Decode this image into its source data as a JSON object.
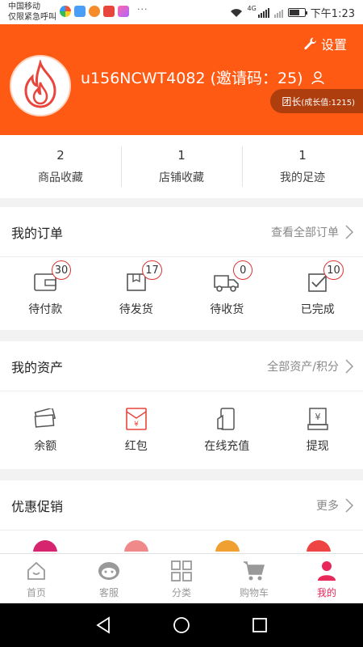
{
  "status_bar": {
    "carrier_line1": "中国移动",
    "carrier_line2": "仅限紧急呼叫",
    "dots": "···",
    "network": "4G",
    "time": "下午1:23"
  },
  "header": {
    "settings_label": "设置",
    "username": "u156NCWT4082 (邀请码：25)",
    "level_label": "团长",
    "growth_label": "(成长值:1215)",
    "bg_color": "#ff5a14"
  },
  "stats": [
    {
      "count": "2",
      "label": "商品收藏"
    },
    {
      "count": "1",
      "label": "店铺收藏"
    },
    {
      "count": "1",
      "label": "我的足迹"
    }
  ],
  "orders": {
    "title": "我的订单",
    "more_label": "查看全部订单",
    "items": [
      {
        "label": "待付款",
        "badge": "30",
        "icon": "wallet-icon"
      },
      {
        "label": "待发货",
        "badge": "17",
        "icon": "package-icon"
      },
      {
        "label": "待收货",
        "badge": "0",
        "icon": "truck-icon"
      },
      {
        "label": "已完成",
        "badge": "10",
        "icon": "checkbox-icon"
      }
    ]
  },
  "assets": {
    "title": "我的资产",
    "more_label": "全部资产/积分",
    "items": [
      {
        "label": "余额",
        "icon": "cash-icon"
      },
      {
        "label": "红包",
        "icon": "red-envelope-icon"
      },
      {
        "label": "在线充值",
        "icon": "recharge-icon"
      },
      {
        "label": "提现",
        "icon": "withdraw-icon"
      }
    ]
  },
  "promotions": {
    "title": "优惠促销",
    "more_label": "更多"
  },
  "tabbar": [
    {
      "label": "首页",
      "icon": "home-icon",
      "active": false
    },
    {
      "label": "客服",
      "icon": "service-icon",
      "active": false
    },
    {
      "label": "分类",
      "icon": "category-icon",
      "active": false
    },
    {
      "label": "购物车",
      "icon": "cart-icon",
      "active": false
    },
    {
      "label": "我的",
      "icon": "profile-icon",
      "active": true
    }
  ],
  "colors": {
    "accent": "#ff5a14",
    "active_tab": "#e8275b",
    "badge_border": "#dd3333"
  }
}
